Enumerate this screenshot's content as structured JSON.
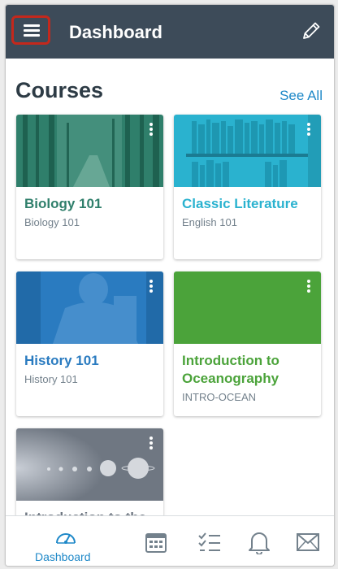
{
  "app_bar": {
    "title": "Dashboard"
  },
  "section": {
    "heading": "Courses",
    "see_all": "See All"
  },
  "courses": [
    {
      "title": "Biology 101",
      "subtitle": "Biology 101",
      "color": "#2f7f6b"
    },
    {
      "title": "Classic Literature",
      "subtitle": "English 101",
      "color": "#2ab2cf"
    },
    {
      "title": "History 101",
      "subtitle": "History 101",
      "color": "#2a7bc0"
    },
    {
      "title": "Introduction to Oceanography",
      "subtitle": "INTRO-OCEAN",
      "color": "#4ba33a"
    },
    {
      "title": "Introduction to the",
      "subtitle": "",
      "color": "#6f7782"
    }
  ],
  "tab_bar": {
    "active_label": "Dashboard",
    "items": [
      "dashboard-icon",
      "calendar-icon",
      "todo-icon",
      "notifications-icon",
      "inbox-icon"
    ]
  },
  "colors": {
    "app_bar": "#3d4b59",
    "accent": "#1e88c8",
    "highlight": "#c4281c"
  }
}
